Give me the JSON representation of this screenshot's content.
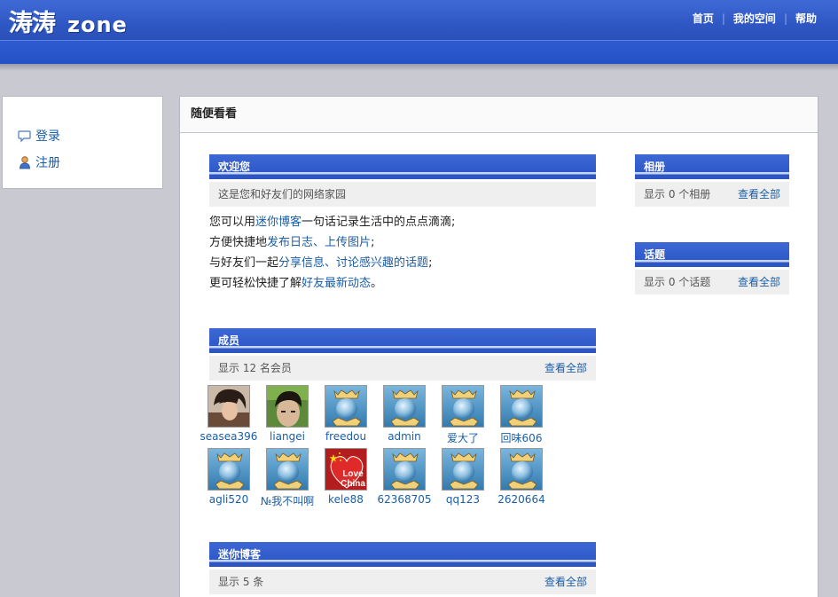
{
  "header": {
    "logo_cn": "涛涛",
    "logo_en": "zone",
    "nav": [
      "首页",
      "我的空间",
      "帮助"
    ]
  },
  "left": {
    "login": "登录",
    "register": "注册"
  },
  "main": {
    "title": "随便看看",
    "welcome": {
      "title": "欢迎您",
      "subtitle": "这是您和好友们的网络家园",
      "lines": [
        {
          "a": "您可以用",
          "b": "迷你博客",
          "c": "一句话记录生活中的点点滴滴;"
        },
        {
          "a": "方便快捷地",
          "b": "发布日志",
          "c": "、",
          "d": "上传图片",
          "e": ";"
        },
        {
          "a": "与好友们一起",
          "b": "分享信息",
          "c": "、",
          "d": "讨论感兴趣的话题",
          "e": ";"
        },
        {
          "a": "更可轻松快捷了解",
          "b": "好友最新动态",
          "c": "。"
        }
      ]
    },
    "members": {
      "title": "成员",
      "count_text": "显示 12 名会员",
      "view_all": "查看全部",
      "list": [
        "seasea396",
        "liangei",
        "freedou",
        "admin",
        "爱大了",
        "回味606",
        "agli520",
        "№我不叫啊",
        "kele88",
        "62368705",
        "qq123",
        "2620664"
      ]
    },
    "miniblog": {
      "title": "迷你博客",
      "count_text": "显示 5 条",
      "view_all": "查看全部"
    },
    "albums": {
      "title": "相册",
      "count_text": "显示 0 个相册",
      "view_all": "查看全部"
    },
    "topics": {
      "title": "话题",
      "count_text": "显示 0 个话题",
      "view_all": "查看全部"
    },
    "avatar_badge": [
      "Love",
      "China"
    ]
  },
  "colors": {
    "header_blue": "#2f57c4",
    "section_blue": "#2e59c9",
    "link": "#1a5ea8",
    "page_bg": "#c9c9d1"
  },
  "icons": {
    "login": "speech-bubble-icon",
    "register": "user-icon",
    "default_avatar": "crown-globe-avatar"
  }
}
